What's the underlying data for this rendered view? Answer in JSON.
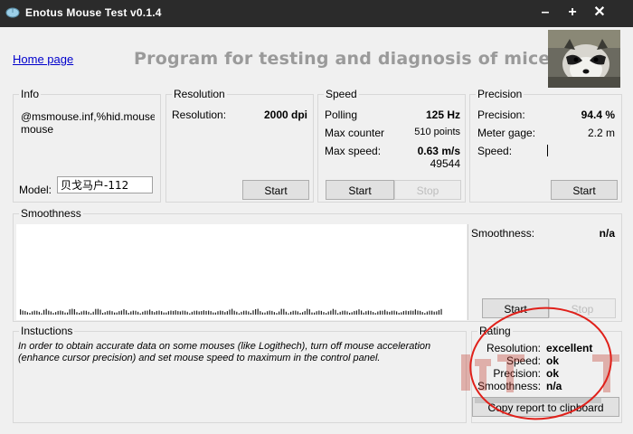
{
  "window": {
    "title": "Enotus Mouse Test v0.1.4",
    "min_glyph": "–",
    "max_glyph": "+",
    "close_glyph": "✕"
  },
  "header": {
    "home_link": "Home page",
    "heading": "Program for testing and diagnosis of mice"
  },
  "info": {
    "title": "Info",
    "device_line1": "@msmouse.inf,%hid.mouse",
    "device_line2": "mouse",
    "model_label": "Model:",
    "model_value": "贝戈马户-112"
  },
  "resolution": {
    "title": "Resolution",
    "label": "Resolution:",
    "value": "2000 dpi",
    "start": "Start"
  },
  "speed": {
    "title": "Speed",
    "polling_label": "Polling",
    "polling_value": "125 Hz",
    "counter_label": "Max counter",
    "counter_value": "510 points",
    "maxspeed_label": "Max  speed:",
    "maxspeed_value": "0.63 m/s",
    "extra_value": "49544",
    "start": "Start",
    "stop": "Stop"
  },
  "precision": {
    "title": "Precision",
    "precision_label": "Precision:",
    "precision_value": "94.4 %",
    "gage_label": "Meter gage:",
    "gage_value": "2.2 m",
    "speed_label": "Speed:",
    "start": "Start"
  },
  "smoothness": {
    "title": "Smoothness",
    "label": "Smoothness:",
    "value": "n/a",
    "start": "Start",
    "stop": "Stop"
  },
  "instructions": {
    "title": "Instuctions",
    "text": "In order to obtain accurate data on some mouses (like Logithech), turn off mouse acceleration (enhance cursor precision) and set mouse speed to maximum in the control panel."
  },
  "rating": {
    "title": "Rating",
    "items": [
      {
        "label": "Resolution:",
        "value": "excellent"
      },
      {
        "label": "Speed:",
        "value": "ok"
      },
      {
        "label": "Precision:",
        "value": "ok"
      },
      {
        "label": "Smoothness:",
        "value": "n/a"
      }
    ],
    "copy_button": "Copy report to clipboard"
  },
  "colors": {
    "titlebar": "#2b2b2b",
    "link": "#0000cc",
    "heading": "#9a9a9a",
    "annotation": "#e0201a"
  }
}
